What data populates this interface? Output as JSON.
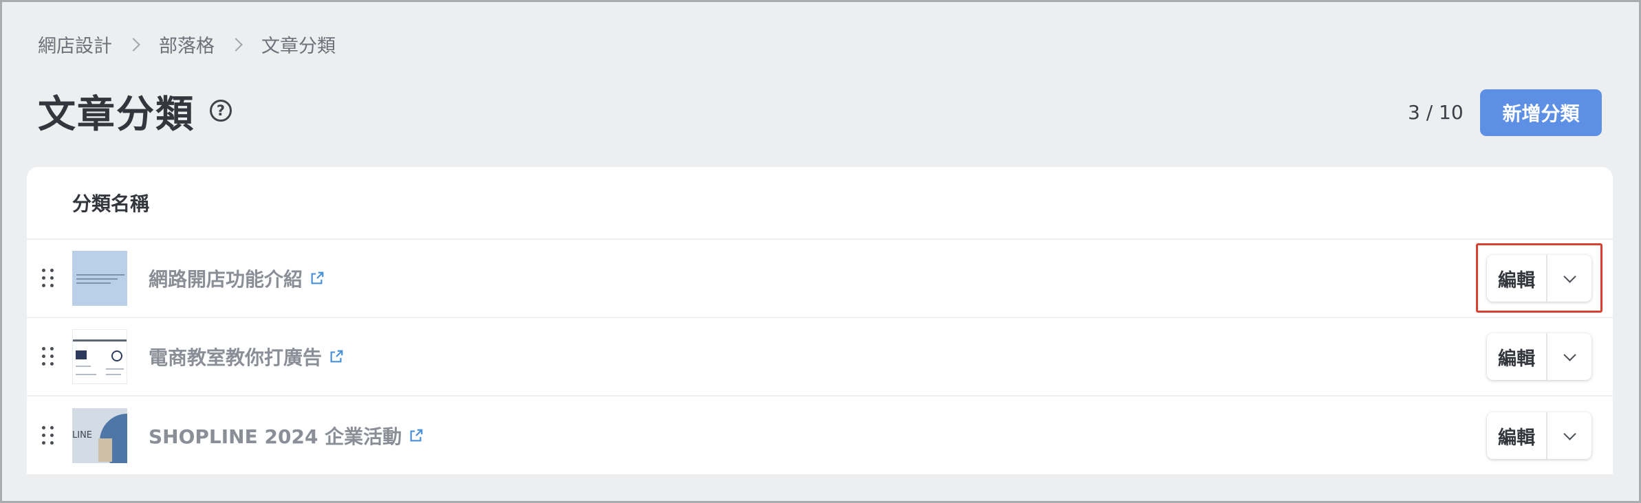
{
  "breadcrumb": [
    "網店設計",
    "部落格",
    "文章分類"
  ],
  "page": {
    "title": "文章分類",
    "help_icon": "question-circle-icon",
    "counter": "3 / 10",
    "add_button": "新增分類"
  },
  "table": {
    "column_header": "分類名稱",
    "rows": [
      {
        "title": "網路開店功能介紹",
        "edit_label": "編輯"
      },
      {
        "title": "電商教室教你打廣告",
        "edit_label": "編輯"
      },
      {
        "title": "SHOPLINE 2024 企業活動",
        "edit_label": "編輯"
      }
    ]
  },
  "thumbnails": {
    "row3_text": "LINE"
  },
  "colors": {
    "primary": "#5d8fe4",
    "highlight": "#d8402f",
    "background": "#edeef0"
  }
}
